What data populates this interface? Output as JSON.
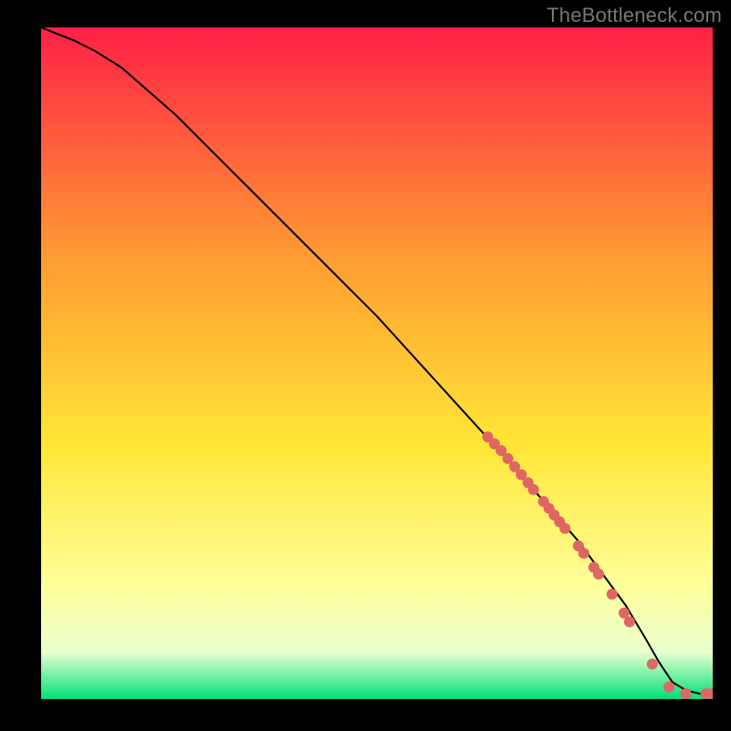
{
  "attribution": "TheBottleneck.com",
  "colors": {
    "frame": "#000000",
    "gradient_top": "#ff2046",
    "gradient_mid1": "#ff9b33",
    "gradient_mid2": "#ffe636",
    "gradient_mid3": "#ffff9a",
    "gradient_mid4": "#eaffcf",
    "gradient_bottom": "#00e07a",
    "curve": "#000000",
    "marker": "#e06666"
  },
  "chart_data": {
    "type": "line",
    "title": "",
    "xlabel": "",
    "ylabel": "",
    "xlim": [
      0,
      100
    ],
    "ylim": [
      0,
      100
    ],
    "series": [
      {
        "name": "curve",
        "x": [
          0,
          5,
          8,
          12,
          20,
          30,
          40,
          50,
          60,
          70,
          80,
          87,
          90,
          92,
          94,
          96,
          98,
          100
        ],
        "y": [
          100,
          98,
          96.5,
          94,
          87,
          77,
          67,
          57,
          46,
          35,
          23.5,
          14,
          9,
          5.5,
          2.5,
          1.3,
          0.8,
          0.8
        ]
      }
    ],
    "markers": [
      {
        "x": 66.5,
        "y": 39,
        "r": 6
      },
      {
        "x": 67.5,
        "y": 38,
        "r": 6
      },
      {
        "x": 68.5,
        "y": 37,
        "r": 6
      },
      {
        "x": 69.5,
        "y": 35.8,
        "r": 6
      },
      {
        "x": 70.5,
        "y": 34.6,
        "r": 6
      },
      {
        "x": 71.5,
        "y": 33.4,
        "r": 6
      },
      {
        "x": 72.5,
        "y": 32.2,
        "r": 6
      },
      {
        "x": 73.3,
        "y": 31.2,
        "r": 6
      },
      {
        "x": 74.8,
        "y": 29.4,
        "r": 6
      },
      {
        "x": 75.6,
        "y": 28.4,
        "r": 6
      },
      {
        "x": 76.4,
        "y": 27.4,
        "r": 6
      },
      {
        "x": 77.2,
        "y": 26.4,
        "r": 6
      },
      {
        "x": 78.0,
        "y": 25.4,
        "r": 6
      },
      {
        "x": 80.0,
        "y": 22.8,
        "r": 6
      },
      {
        "x": 80.8,
        "y": 21.7,
        "r": 6
      },
      {
        "x": 82.3,
        "y": 19.6,
        "r": 6
      },
      {
        "x": 83.0,
        "y": 18.6,
        "r": 6
      },
      {
        "x": 85.0,
        "y": 15.6,
        "r": 6
      },
      {
        "x": 86.8,
        "y": 12.8,
        "r": 6
      },
      {
        "x": 87.6,
        "y": 11.5,
        "r": 6
      },
      {
        "x": 91.0,
        "y": 5.2,
        "r": 6
      },
      {
        "x": 93.5,
        "y": 1.8,
        "r": 6
      },
      {
        "x": 96.0,
        "y": 0.8,
        "r": 6
      },
      {
        "x": 99.0,
        "y": 0.8,
        "r": 6
      },
      {
        "x": 100.0,
        "y": 0.8,
        "r": 6
      }
    ]
  }
}
